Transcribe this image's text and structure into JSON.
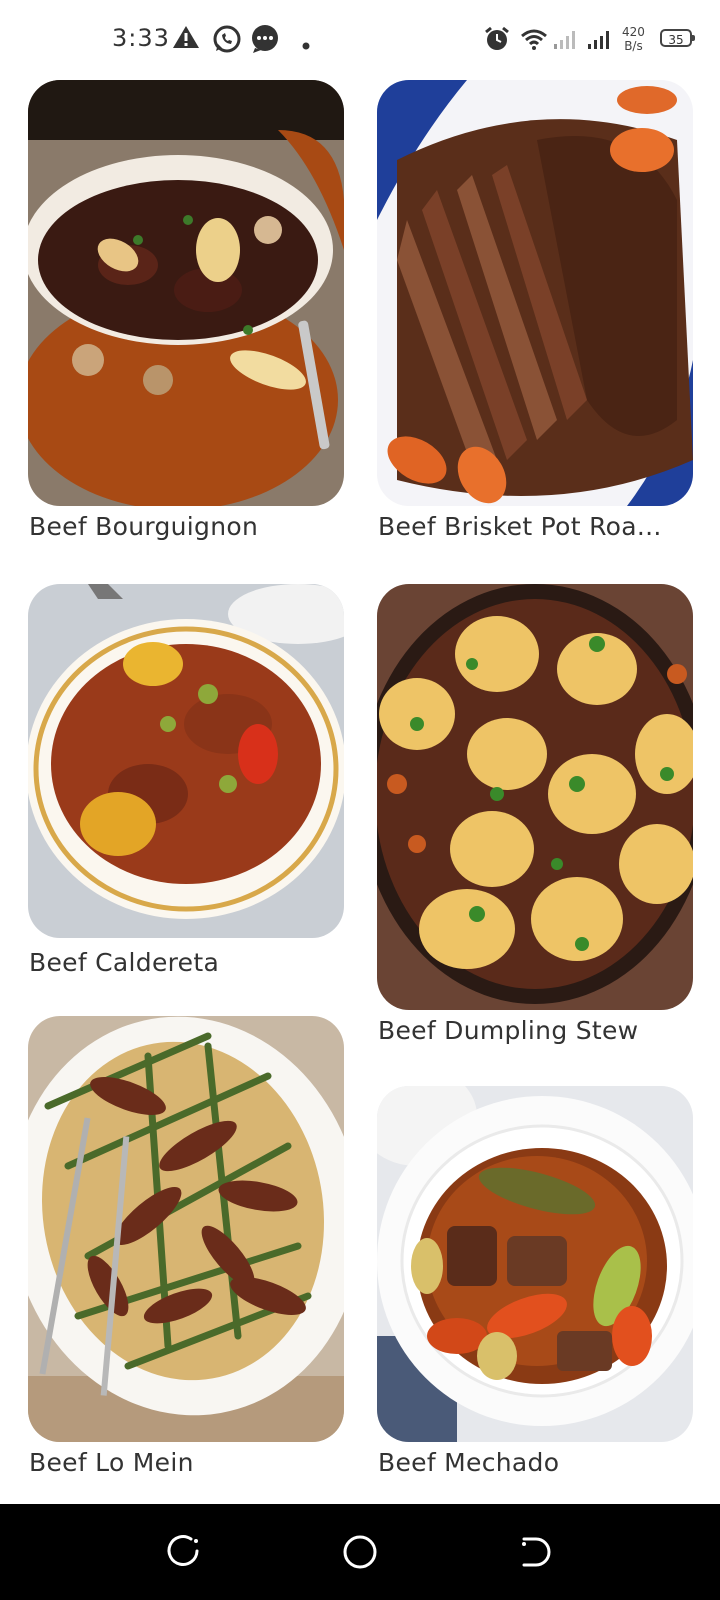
{
  "status_bar": {
    "time": "3:33",
    "net_speed_value": "420",
    "net_speed_unit": "B/s",
    "battery": "35"
  },
  "recipes": [
    {
      "title": "Beef Bourguignon"
    },
    {
      "title": "Beef Brisket Pot Roa..."
    },
    {
      "title": "Beef Caldereta"
    },
    {
      "title": "Beef Dumpling Stew"
    },
    {
      "title": "Beef Lo Mein"
    },
    {
      "title": "Beef Mechado"
    }
  ]
}
